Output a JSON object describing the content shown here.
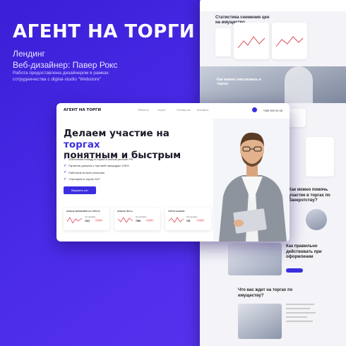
{
  "cover": {
    "title": "АГЕНТ НА ТОРГИ",
    "subtitle": "Лендинг",
    "designer": "Веб-дизайнер: Павер Рокс",
    "note": "Работа предоставлена дизайнером в рамках сотрудничества с digital-studio \"Webstore\""
  },
  "landing": {
    "logo": "АГЕНТ НА ТОРГИ",
    "nav": [
      "Объекты",
      "Услуги",
      "Почему мы",
      "Контакты"
    ],
    "phone": "+380 999 30 08",
    "hero_line1": "Делаем участие на ",
    "hero_accent": "торгах",
    "hero_line2": "понятным и быстрым",
    "bullets": [
      "Обеспечим победу в торгах в любом регионе РФ",
      "Гарантия допуска к торговой процедуре 100%",
      "Работаем во всех регионах",
      "Участвуем в торгах 24/7"
    ],
    "cta": "Выкупить лот",
    "stats": [
      {
        "label": "Новые должники на торгах",
        "caption": "На продажу",
        "v1": "1922",
        "v2": "-5.2%"
      },
      {
        "label": "Новые лоты",
        "caption": "На продажу",
        "v1": "7968",
        "v2": "-3.1%"
      },
      {
        "label": "Торги банков",
        "caption": "На продажу",
        "v1": "195",
        "v2": "-2.4%"
      }
    ]
  },
  "side": {
    "stat_title": "Статистика снижения цен на имущество",
    "mid_title": "Как можно участвовать в торгах",
    "q1": "Как можно помочь участие в торгах по банкротству?",
    "q2": "Как правильно действовать при оформлении",
    "q3": "Что вас ждет на торгах по имуществу?"
  },
  "colors": {
    "accent": "#3b2ee0",
    "background": "#4a2be8",
    "negative": "#e04a5a"
  }
}
